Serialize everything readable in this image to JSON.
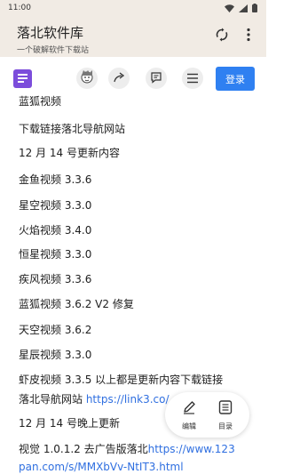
{
  "status": {
    "time": "11:00"
  },
  "appbar": {
    "title": "落北软件库",
    "subtitle": "一个破解软件下载站"
  },
  "toolbar": {
    "login_label": "登录"
  },
  "content": {
    "lines": [
      {
        "text": "蓝狐视频"
      },
      {
        "text": "下载链接落北导航网站"
      },
      {
        "text": "12 月 14 号更新内容"
      },
      {
        "text": "金鱼视频 3.3.6"
      },
      {
        "text": "星空视频 3.3.0"
      },
      {
        "text": "火焰视频 3.4.0"
      },
      {
        "text": "恒星视频 3.3.0"
      },
      {
        "text": "疾风视频 3.3.6"
      },
      {
        "text": "蓝狐视频 3.6.2 V2 修复"
      },
      {
        "text": "天空视频 3.6.2"
      },
      {
        "text": "星辰视频 3.3.0"
      },
      {
        "text": "虾皮视频 3.3.5 以上都是更新内容下载链接"
      },
      {
        "text": "落北导航网站 ",
        "link": "https://link3.co/"
      },
      {
        "text": "12 月 14 号晚上更新"
      },
      {
        "text": "视觉 1.0.1.2 去广告版落北",
        "link": "https://www.123"
      },
      {
        "text": "",
        "link": "pan.com/s/MMXbVv-NtIT3.html"
      }
    ]
  },
  "fab": {
    "edit_label": "编辑",
    "toc_label": "目录"
  }
}
